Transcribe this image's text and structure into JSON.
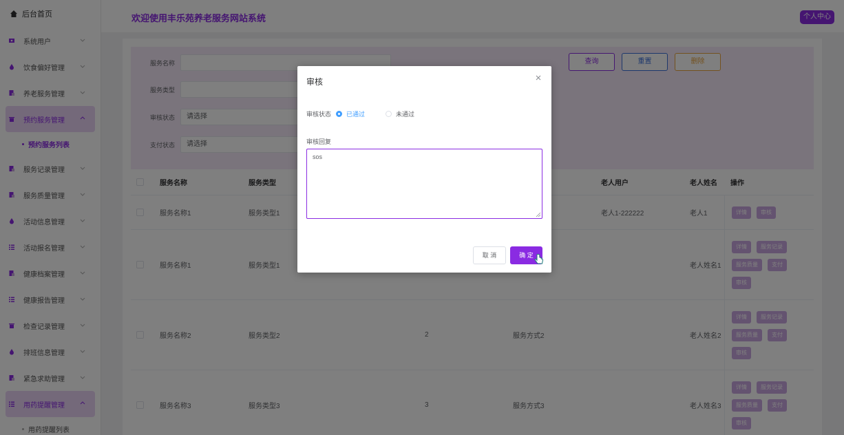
{
  "sidebar": {
    "home": "后台首页",
    "items": [
      {
        "label": "系统用户",
        "icon": "user-card-icon"
      },
      {
        "label": "饮食偏好管理",
        "icon": "drop-icon"
      },
      {
        "label": "养老服务管理",
        "icon": "document-icon"
      },
      {
        "label": "预约服务管理",
        "icon": "trash-icon"
      },
      {
        "label": "服务记录管理",
        "icon": "document-icon"
      },
      {
        "label": "服务质量管理",
        "icon": "document-icon"
      },
      {
        "label": "活动信息管理",
        "icon": "drop-icon"
      },
      {
        "label": "活动报名管理",
        "icon": "list-icon"
      },
      {
        "label": "健康档案管理",
        "icon": "document-icon"
      },
      {
        "label": "健康报告管理",
        "icon": "list-icon"
      },
      {
        "label": "检查记录管理",
        "icon": "trash-icon"
      },
      {
        "label": "排班信息管理",
        "icon": "drop-icon"
      },
      {
        "label": "紧急求助管理",
        "icon": "document-icon"
      },
      {
        "label": "用药提醒管理",
        "icon": "list-icon"
      }
    ],
    "sub_appointment": "预约服务列表",
    "sub_medication": "用药提醒列表"
  },
  "header": {
    "title": "欢迎使用丰乐苑养老服务网站系统",
    "user_center": "个人中心"
  },
  "search": {
    "service_name_label": "服务名称",
    "service_type_label": "服务类型",
    "audit_status_label": "审核状态",
    "audit_status_value": "请选择",
    "pay_status_label": "支付状态",
    "pay_status_value": "请选择",
    "query": "查询",
    "reset": "重置",
    "delete": "删除"
  },
  "table": {
    "headers": [
      "服务名称",
      "服务类型",
      "老人用户",
      "老人姓名",
      "操作"
    ],
    "rows": [
      {
        "name": "服务名称1",
        "type": "服务类型1",
        "num": "",
        "method": "",
        "user": "老人1-222222",
        "elder": "老人1"
      },
      {
        "name": "服务名称1",
        "type": "服务类型1",
        "num": "",
        "method": "",
        "user": "",
        "elder": "老人姓名1"
      },
      {
        "name": "服务名称2",
        "type": "服务类型2",
        "num": "2",
        "method": "服务方式2",
        "user": "",
        "elder": "老人姓名2"
      },
      {
        "name": "服务名称3",
        "type": "服务类型3",
        "num": "3",
        "method": "服务方式3",
        "user": "",
        "elder": "老人姓名3"
      }
    ],
    "ops": {
      "detail": "详情",
      "audit": "审核",
      "record": "服务记录",
      "quality": "服务质量",
      "pay": "支付"
    }
  },
  "modal": {
    "title": "审核",
    "audit_status_label": "审核状态",
    "option_pass": "已通过",
    "option_fail": "未通过",
    "selected": "已通过",
    "reply_label": "审核回复",
    "reply_value": "sos",
    "cancel": "取 消",
    "confirm": "确 定"
  },
  "colors": {
    "accent": "#8a2be2",
    "radio_blue": "#409eff"
  }
}
